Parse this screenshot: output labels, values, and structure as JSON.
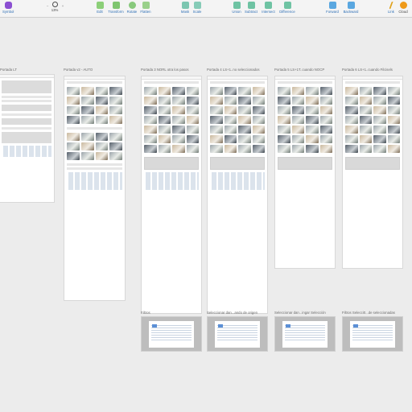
{
  "toolbar": {
    "symbol": "Symbol",
    "zoom_value": "13%",
    "zoom_minus": "−",
    "zoom_plus": "+",
    "edit": "Edit",
    "transform": "Transform",
    "rotate": "Rotate",
    "flatten": "Flatten",
    "mask": "Mask",
    "scale": "Scale",
    "union": "Union",
    "subtract": "Subtract",
    "intersect": "Intersect",
    "difference": "Difference",
    "forward": "Forward",
    "backward": "Backward",
    "link": "Link",
    "cloud": "Cloud"
  },
  "artboards": {
    "a0": "Portada LT",
    "a1": "Portada v2 - AUTO",
    "a2": "Portada 3 NORL otra los pasos",
    "a3": "Portada 4 LS+1..no seleccionados",
    "a4": "Portada 5 LS+1T..cuando NOCP",
    "a5": "Portada 6 LS+1..cuando Filcisels",
    "f1": "Filtros",
    "f2": "Seleccionar dan...ando de origen",
    "f3": "Seleccionar dan...ingar Selección",
    "f4": "Filtros Selecci0...de seleccionadas"
  },
  "colors": {
    "accent": "#2f6fb5",
    "green": "#6cc04a",
    "canvas": "#ececec"
  }
}
